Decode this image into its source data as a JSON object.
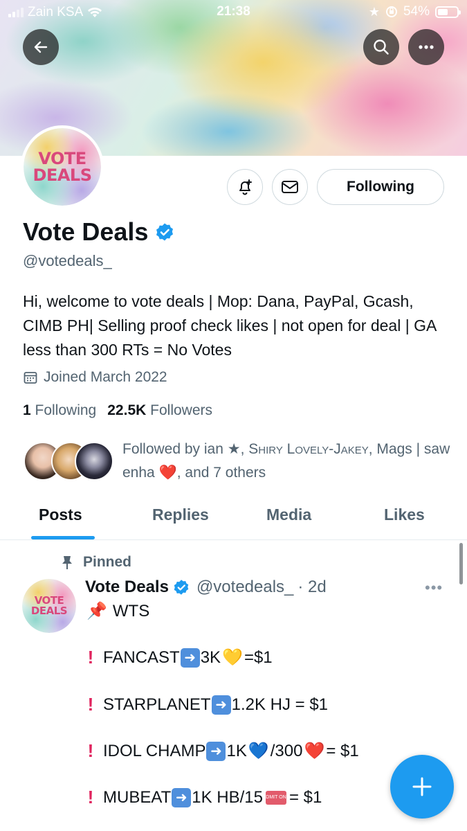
{
  "status_bar": {
    "carrier": "Zain KSA",
    "time": "21:38",
    "battery_percent": "54%",
    "battery_level": 0.54
  },
  "header": {
    "back_icon": "arrow-left-icon",
    "search_icon": "search-icon",
    "more_icon": "more-horizontal-icon"
  },
  "profile": {
    "avatar_text_line1": "VOTE",
    "avatar_text_line2": "DEALS",
    "display_name": "Vote Deals",
    "handle": "@votedeals_",
    "bio": "Hi, welcome to vote deals | Mop: Dana, PayPal, Gcash, CIMB PH| Selling proof check likes | not open for deal | GA less than 300 RTs = No Votes",
    "joined": "Joined March 2022",
    "following_count": "1",
    "following_label": "Following",
    "followers_count": "22.5K",
    "followers_label": "Followers",
    "follow_button_label": "Following",
    "followed_by_prefix": "Followed by ian ★, ",
    "followed_by_smallcaps": "Shiry Lovely-Jakey",
    "followed_by_suffix": ", Mags | saw enha ",
    "followed_by_heart": "❤️",
    "followed_by_end": ", and 7 others"
  },
  "tabs": [
    {
      "label": "Posts",
      "active": true
    },
    {
      "label": "Replies",
      "active": false
    },
    {
      "label": "Media",
      "active": false
    },
    {
      "label": "Likes",
      "active": false
    }
  ],
  "post": {
    "pinned_label": "Pinned",
    "author_name": "Vote Deals",
    "author_handle": "@votedeals_",
    "time_ago": "· 2d",
    "line_wts": "WTS",
    "line_wts_emoji": "📌",
    "lines": [
      {
        "pre": "FANCAST",
        "post": "3K",
        "emoji": "💛",
        "tail": "=$1"
      },
      {
        "pre": "STARPLANET",
        "post": "1.2K HJ = $1"
      },
      {
        "pre": "IDOL CHAMP",
        "post": "1K",
        "emoji": "💙",
        "mid": "/300",
        "emoji2": "❤️",
        "tail": " = $1"
      },
      {
        "pre": "MUBEAT",
        "post": "1K HB/15",
        "ticket": "ADMIT ONE",
        "tail": " = $1"
      }
    ],
    "excl": "❗",
    "arrow": "➡"
  },
  "fab_icon": "plus-icon"
}
